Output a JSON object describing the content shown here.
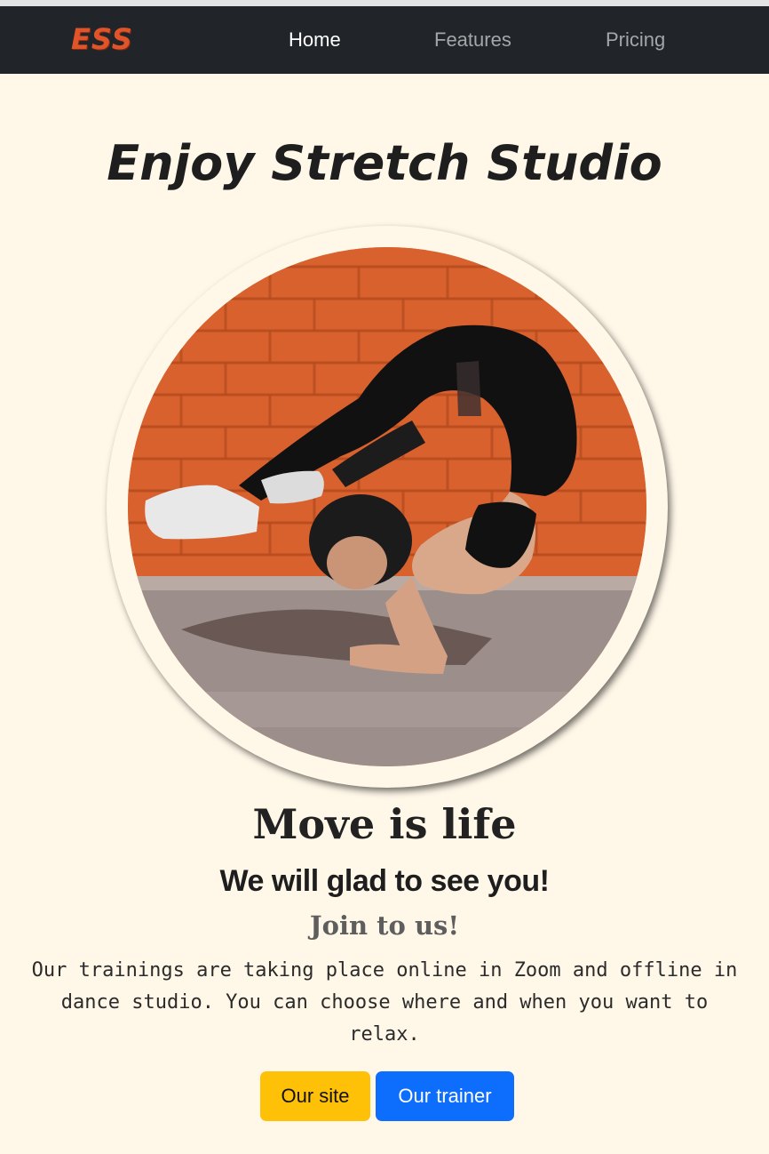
{
  "navbar": {
    "brand": "ESS",
    "links": [
      {
        "label": "Home",
        "active": true
      },
      {
        "label": "Features",
        "active": false
      },
      {
        "label": "Pricing",
        "active": false
      }
    ]
  },
  "hero": {
    "title": "Enjoy Stretch Studio",
    "image_alt": "woman-backbend-stretch-photo"
  },
  "content": {
    "heading": "Move is life",
    "subheading": "We will glad to see you!",
    "tagline": "Join to us!",
    "description": "Our trainings are taking place online in Zoom and offline in dance studio. You can choose where and when you want to relax."
  },
  "buttons": {
    "site_label": "Our site",
    "trainer_label": "Our trainer"
  },
  "colors": {
    "background": "#fff7e8",
    "navbar": "#212529",
    "brand": "#e0542a",
    "primary_button": "#0d6efd",
    "warning_button": "#ffc107"
  }
}
